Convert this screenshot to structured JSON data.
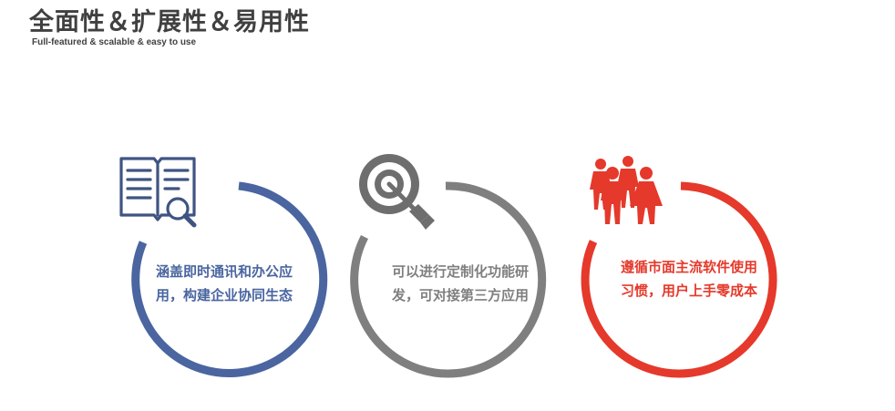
{
  "header": {
    "title": "全面性＆扩展性＆易用性",
    "subtitle": "Full-featured & scalable & easy to use"
  },
  "features": [
    {
      "icon": "book-search-icon",
      "color": "#4a65a0",
      "line1": "涵盖即时通讯和办公应",
      "line2": "用，构建企业协同生态"
    },
    {
      "icon": "target-arrow-icon",
      "color": "#7f7f7f",
      "line1": "可以进行定制化功能研",
      "line2": "发，可对接第三方应用"
    },
    {
      "icon": "people-group-icon",
      "color": "#e5392b",
      "line1": "遵循市面主流软件使用",
      "line2": "习惯，用户上手零成本"
    }
  ]
}
